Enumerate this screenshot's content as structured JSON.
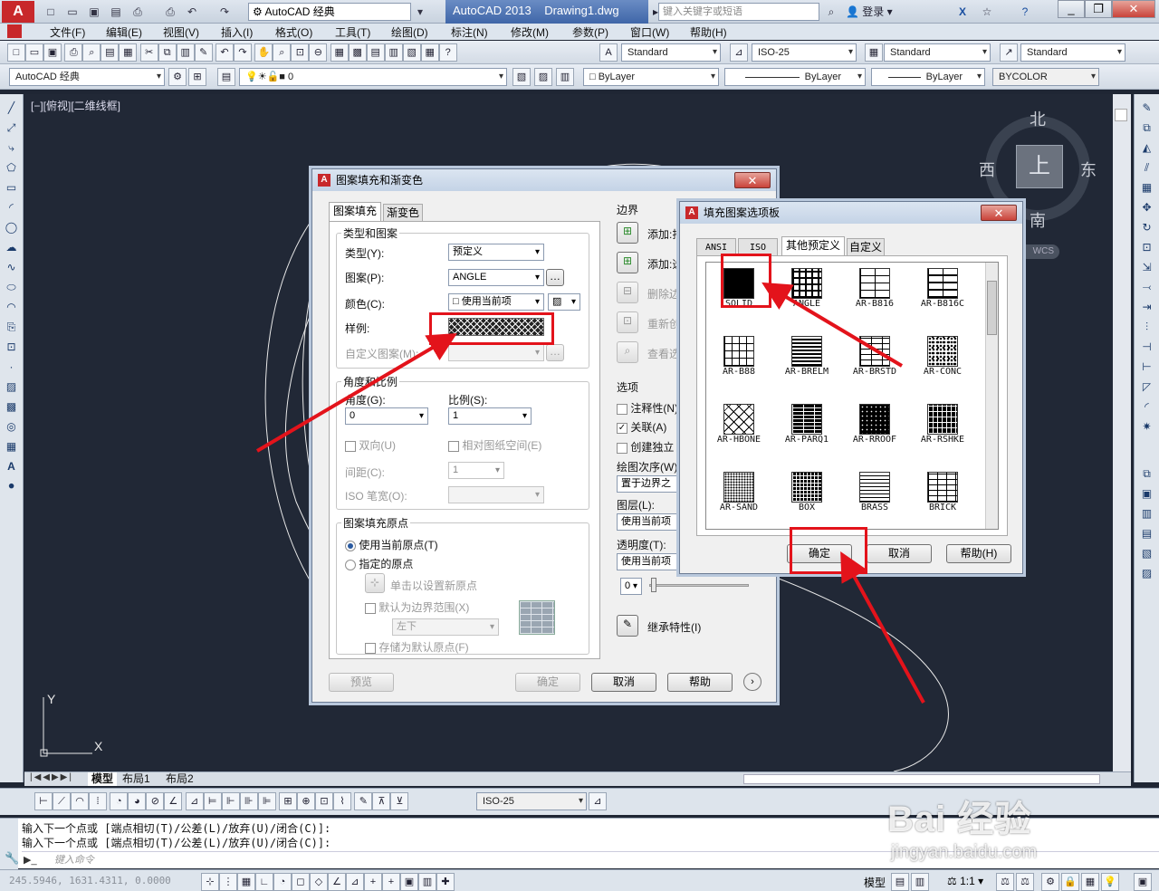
{
  "app": {
    "logo": "A",
    "workspace": "AutoCAD 经典",
    "title": "AutoCAD 2013",
    "drawing": "Drawing1.dwg",
    "search_placeholder": "键入关键字或短语",
    "login": "登录"
  },
  "menu": [
    "文件(F)",
    "编辑(E)",
    "视图(V)",
    "插入(I)",
    "格式(O)",
    "工具(T)",
    "绘图(D)",
    "标注(N)",
    "修改(M)",
    "参数(P)",
    "窗口(W)",
    "帮助(H)"
  ],
  "toolbar": {
    "text_style": "Standard",
    "dim_style": "ISO-25",
    "table_style": "Standard",
    "mleader_style": "Standard",
    "workspace2": "AutoCAD 经典",
    "layer": "0",
    "color": "ByLayer",
    "linetype": "ByLayer",
    "lineweight": "ByLayer",
    "plotstyle": "BYCOLOR"
  },
  "canvas": {
    "view_label": "[−][俯视][二维线框]",
    "compass": {
      "n": "北",
      "s": "南",
      "e": "东",
      "w": "西",
      "center": "上",
      "wcs": "WCS"
    },
    "ucs_y": "Y",
    "ucs_x": "X"
  },
  "layout_tabs": [
    "模型",
    "布局1",
    "布局2"
  ],
  "dim_toolbar_style": "ISO-25",
  "command": {
    "line1": "输入下一个点或 [端点相切(T)/公差(L)/放弃(U)/闭合(C)]:",
    "line2": "输入下一个点或 [端点相切(T)/公差(L)/放弃(U)/闭合(C)]:",
    "prompt": "键入命令"
  },
  "status": {
    "coords": "245.5946, 1631.4311, 0.0000",
    "model": "模型",
    "scale": "1:1"
  },
  "hatch_dialog": {
    "title": "图案填充和渐变色",
    "tabs": [
      "图案填充",
      "渐变色"
    ],
    "type_group": "类型和图案",
    "type_label": "类型(Y):",
    "type_value": "预定义",
    "pattern_label": "图案(P):",
    "pattern_value": "ANGLE",
    "color_label": "颜色(C):",
    "color_value": "使用当前项",
    "sample_label": "样例:",
    "custom_label": "自定义图案(M):",
    "angle_group": "角度和比例",
    "angle_label": "角度(G):",
    "angle_value": "0",
    "scale_label": "比例(S):",
    "scale_value": "1",
    "double_label": "双向(U)",
    "relative_label": "相对图纸空间(E)",
    "spacing_label": "间距(C):",
    "spacing_value": "1",
    "iso_label": "ISO 笔宽(O):",
    "origin_group": "图案填充原点",
    "use_current_origin": "使用当前原点(T)",
    "specified_origin": "指定的原点",
    "click_set_origin": "单击以设置新原点",
    "default_boundary": "默认为边界范围(X)",
    "position_value": "左下",
    "store_default": "存储为默认原点(F)",
    "boundary_group": "边界",
    "add_pick": "添加:拾",
    "add_select": "添加:选",
    "remove": "删除边",
    "recreate": "重新创",
    "view_sel": "查看选",
    "options_group": "选项",
    "annotative": "注释性(N)",
    "associative": "关联(A)",
    "separate": "创建独立",
    "draw_order_label": "绘图次序(W)",
    "draw_order_value": "置于边界之",
    "layer_label": "图层(L):",
    "layer_value": "使用当前项",
    "transparency_label": "透明度(T):",
    "transparency_value": "使用当前项",
    "transparency_num": "0",
    "inherit": "继承特性(I)",
    "preview_btn": "预览",
    "ok_btn": "确定",
    "cancel_btn": "取消",
    "help_btn": "帮助"
  },
  "palette_dialog": {
    "title": "填充图案选项板",
    "tabs": [
      "ANSI",
      "ISO",
      "其他预定义",
      "自定义"
    ],
    "patterns": [
      "SOLID",
      "ANGLE",
      "AR-B816",
      "AR-B816C",
      "AR-B88",
      "AR-BRELM",
      "AR-BRSTD",
      "AR-CONC",
      "AR-HBONE",
      "AR-PARQ1",
      "AR-RROOF",
      "AR-RSHKE",
      "AR-SAND",
      "BOX",
      "BRASS",
      "BRICK"
    ],
    "ok_btn": "确定",
    "cancel_btn": "取消",
    "help_btn": "帮助(H)"
  },
  "watermark": {
    "brand": "Bai 经验",
    "url": "jingyan.baidu.com"
  },
  "colors": {
    "canvas": "#212836",
    "accent": "#e3131b",
    "title_active": "#3f66a8"
  }
}
